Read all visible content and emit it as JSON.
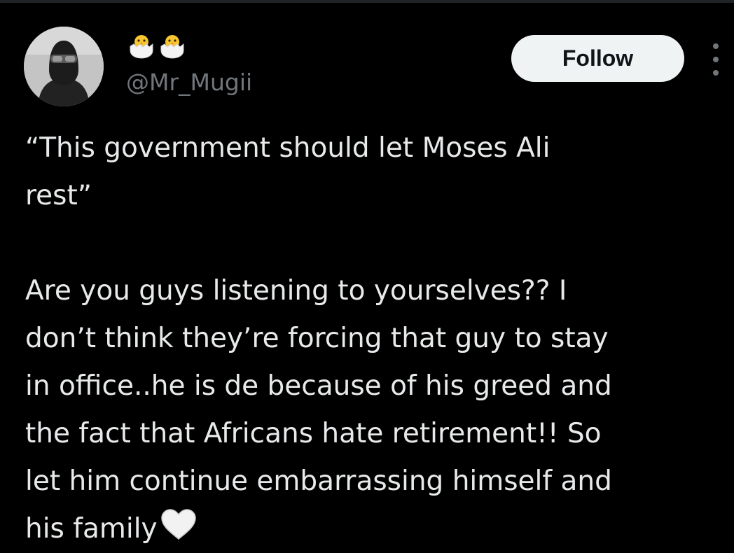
{
  "header": {
    "display_name_emojis": [
      "hatching-chick-icon",
      "hatching-chick-icon"
    ],
    "handle": "@Mr_Mugii",
    "follow_label": "Follow"
  },
  "tweet": {
    "paragraph_1": [
      "“This government should let Moses Ali",
      "rest”"
    ],
    "paragraph_2": [
      "Are you guys listening to yourselves?? I",
      "don’t think they’re forcing that guy to stay",
      "in office..he is de because of his greed and",
      "the fact that Africans hate retirement!! So",
      "let him continue embarrassing himself and",
      "his family"
    ],
    "trailing_emoji": "white-heart-icon"
  },
  "colors": {
    "background": "#000000",
    "text_primary": "#e7e9ea",
    "text_secondary": "#71767b",
    "button_bg": "#eff3f4",
    "button_text": "#0f1419"
  }
}
